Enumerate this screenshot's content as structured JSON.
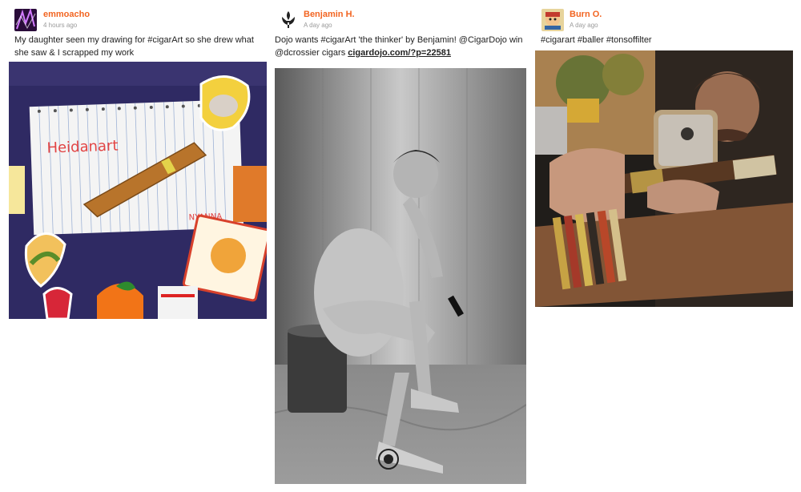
{
  "posts": [
    {
      "username": "emmoacho",
      "time": "4 hours ago",
      "caption": "My daughter seen my drawing for #cigarArt so she drew what she saw & I scrapped my work",
      "drawing_text": "Heidanart",
      "drawing_sig": "NYANNA"
    },
    {
      "username": "Benjamin H.",
      "time": "A day ago",
      "caption_text": "Dojo wants #cigarArt 'the thinker' by Benjamin! @CigarDojo win @dcrossier cigars ",
      "caption_link": "cigardojo.com/?p=22581"
    },
    {
      "username": "Burn O.",
      "time": "A day ago",
      "caption": "#cigarart #baller #tonsoffilter"
    }
  ]
}
